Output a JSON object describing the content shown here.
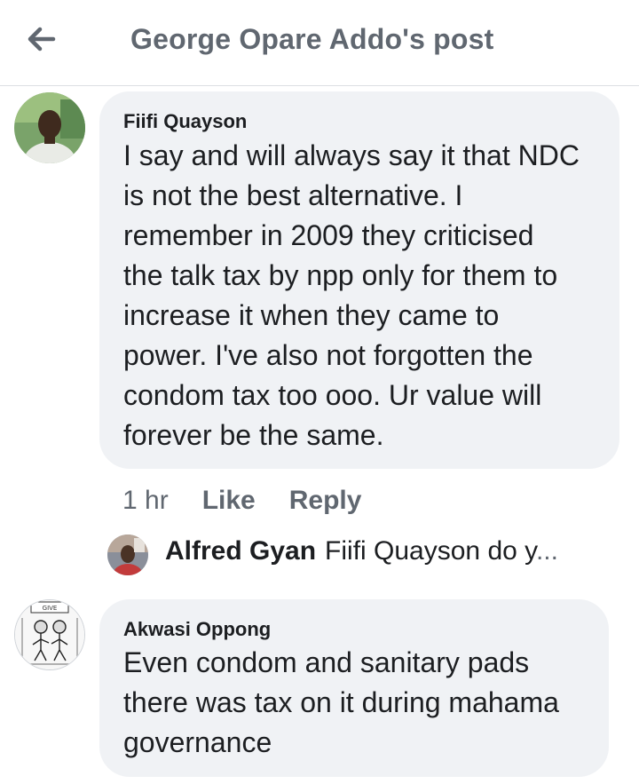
{
  "header": {
    "title": "George Opare Addo's post"
  },
  "comments": [
    {
      "author": "Fiifi Quayson",
      "text": "I say and will always say it that NDC\nis not the best alternative.    I\nremember in 2009 they criticised\nthe talk tax by npp only for them to\nincrease it when they came to\npower. I've also not forgotten the\ncondom tax too ooo. Ur value will\nforever be the same.",
      "time": "1 hr",
      "like_label": "Like",
      "reply_label": "Reply",
      "reply_preview": {
        "author": "Alfred Gyan",
        "snippet": "Fiifi Quayson do y",
        "ellipsis": "..."
      }
    },
    {
      "author": "Akwasi Oppong",
      "text": "Even condom and sanitary pads\nthere was tax on it during mahama\ngovernance",
      "avatar_caption": "GIVE"
    }
  ],
  "colors": {
    "bubble": "#f0f2f5",
    "secondary_text": "#606770",
    "primary_text": "#1c1e21",
    "divider": "#dcdfe3"
  },
  "icons": {
    "back": "arrow-left-icon"
  }
}
